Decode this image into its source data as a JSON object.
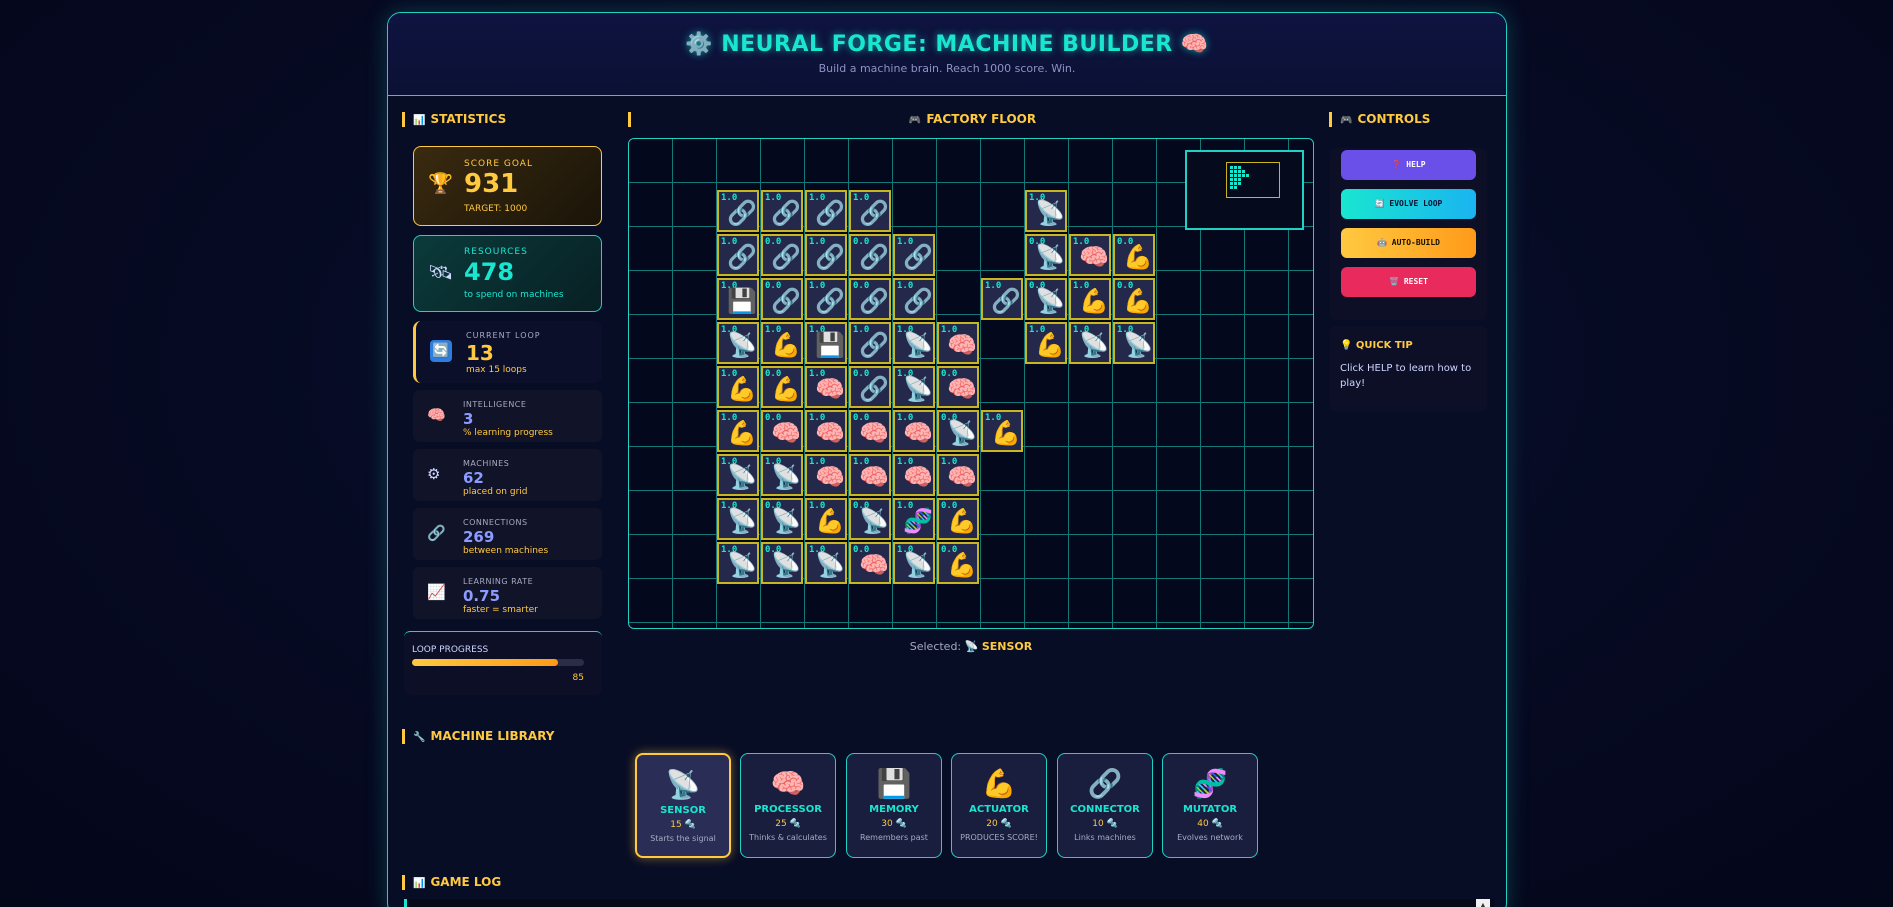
{
  "header": {
    "title": "⚙️ NEURAL FORGE: MACHINE BUILDER 🧠",
    "subtitle": "Build a machine brain. Reach 1000 score. Win."
  },
  "stats": {
    "heading": "STATISTICS",
    "heading_icon": "📊",
    "score": {
      "label": "SCORE GOAL",
      "value": "931",
      "sub": "TARGET: 1000",
      "icon": "🏆"
    },
    "resources": {
      "label": "RESOURCES",
      "value": "478",
      "sub": "to spend on machines",
      "icon": "🛰"
    },
    "loop": {
      "label": "CURRENT LOOP",
      "value": "13",
      "sub": "max 15 loops",
      "icon": "🔄"
    },
    "intelligence": {
      "label": "INTELLIGENCE",
      "value": "3",
      "sub": "% learning progress",
      "icon": "🧠"
    },
    "machines": {
      "label": "MACHINES",
      "value": "62",
      "sub": "placed on grid",
      "icon": "⚙"
    },
    "connections": {
      "label": "CONNECTIONS",
      "value": "269",
      "sub": "between machines",
      "icon": "🔗"
    },
    "learning": {
      "label": "LEARNING RATE",
      "value": "0.75",
      "sub": "faster = smarter",
      "icon": "📈"
    },
    "progress": {
      "label": "LOOP PROGRESS",
      "value": "85",
      "fraction": 0.85
    }
  },
  "factory": {
    "heading": "FACTORY FLOOR",
    "heading_icon": "🎮",
    "selected_label": "Selected:",
    "selected_icon": "📡",
    "selected_name": "SENSOR",
    "rows": [
      [
        2,
        "L",
        "1.0"
      ],
      [
        3,
        "L",
        "1.0"
      ],
      [
        4,
        "L",
        "1.0"
      ],
      [
        5,
        "L",
        "1.0"
      ],
      [
        9,
        "S",
        "1.0"
      ]
    ]
  },
  "controls": {
    "heading": "CONTROLS",
    "heading_icon": "🎮",
    "help": "❓ HELP",
    "evolve": "🔄 EVOLVE LOOP",
    "auto": "🤖 AUTO-BUILD",
    "reset": "🗑️ RESET"
  },
  "tip": {
    "heading": "💡 QUICK TIP",
    "text": "Click HELP to learn how to play!"
  },
  "library": {
    "heading": "MACHINE LIBRARY",
    "heading_icon": "🔧",
    "items": [
      {
        "icon": "📡",
        "name": "SENSOR",
        "cost": "15 🔩",
        "desc": "Starts the signal"
      },
      {
        "icon": "🧠",
        "name": "PROCESSOR",
        "cost": "25 🔩",
        "desc": "Thinks & calculates"
      },
      {
        "icon": "💾",
        "name": "MEMORY",
        "cost": "30 🔩",
        "desc": "Remembers past"
      },
      {
        "icon": "💪",
        "name": "ACTUATOR",
        "cost": "20 🔩",
        "desc": "PRODUCES SCORE!"
      },
      {
        "icon": "🔗",
        "name": "CONNECTOR",
        "cost": "10 🔩",
        "desc": "Links machines"
      },
      {
        "icon": "🧬",
        "name": "MUTATOR",
        "cost": "40 🔩",
        "desc": "Evolves network"
      }
    ]
  },
  "log": {
    "heading": "GAME LOG",
    "heading_icon": "📊"
  },
  "colors": {
    "accent": "#19e6d0",
    "gold": "#ffc940",
    "panel": "#080d26"
  }
}
